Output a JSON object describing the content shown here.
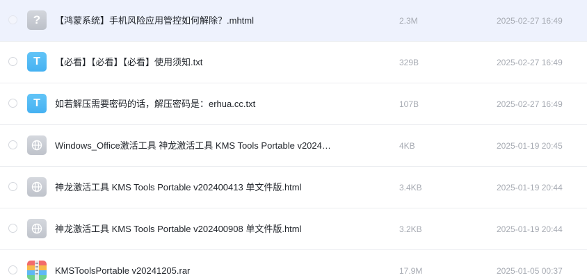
{
  "files": [
    {
      "icon": "unknown-file-icon",
      "glyph": "?",
      "name": "【鸿蒙系统】手机风险应用管控如何解除？.mhtml",
      "size": "2.3M",
      "date": "2025-02-27 16:49",
      "selected": true
    },
    {
      "icon": "txt-file-icon",
      "glyph": "T",
      "name": "【必看】【必看】【必看】使用须知.txt",
      "size": "329B",
      "date": "2025-02-27 16:49",
      "selected": false
    },
    {
      "icon": "txt-file-icon",
      "glyph": "T",
      "name": "如若解压需要密码的话，解压密码是：erhua.cc.txt",
      "size": "107B",
      "date": "2025-02-27 16:49",
      "selected": false
    },
    {
      "icon": "html-file-icon",
      "glyph": "",
      "name": "Windows_Office激活工具 神龙激活工具 KMS Tools Portable v2024…",
      "size": "4KB",
      "date": "2025-01-19 20:45",
      "selected": false
    },
    {
      "icon": "html-file-icon",
      "glyph": "",
      "name": "神龙激活工具 KMS Tools Portable v202400413 单文件版.html",
      "size": "3.4KB",
      "date": "2025-01-19 20:44",
      "selected": false
    },
    {
      "icon": "html-file-icon",
      "glyph": "",
      "name": "神龙激活工具 KMS Tools Portable v202400908 单文件版.html",
      "size": "3.2KB",
      "date": "2025-01-19 20:44",
      "selected": false
    },
    {
      "icon": "rar-file-icon",
      "glyph": "",
      "name": "KMSToolsPortable v20241205.rar",
      "size": "17.9M",
      "date": "2025-01-05 00:37",
      "selected": false
    }
  ]
}
